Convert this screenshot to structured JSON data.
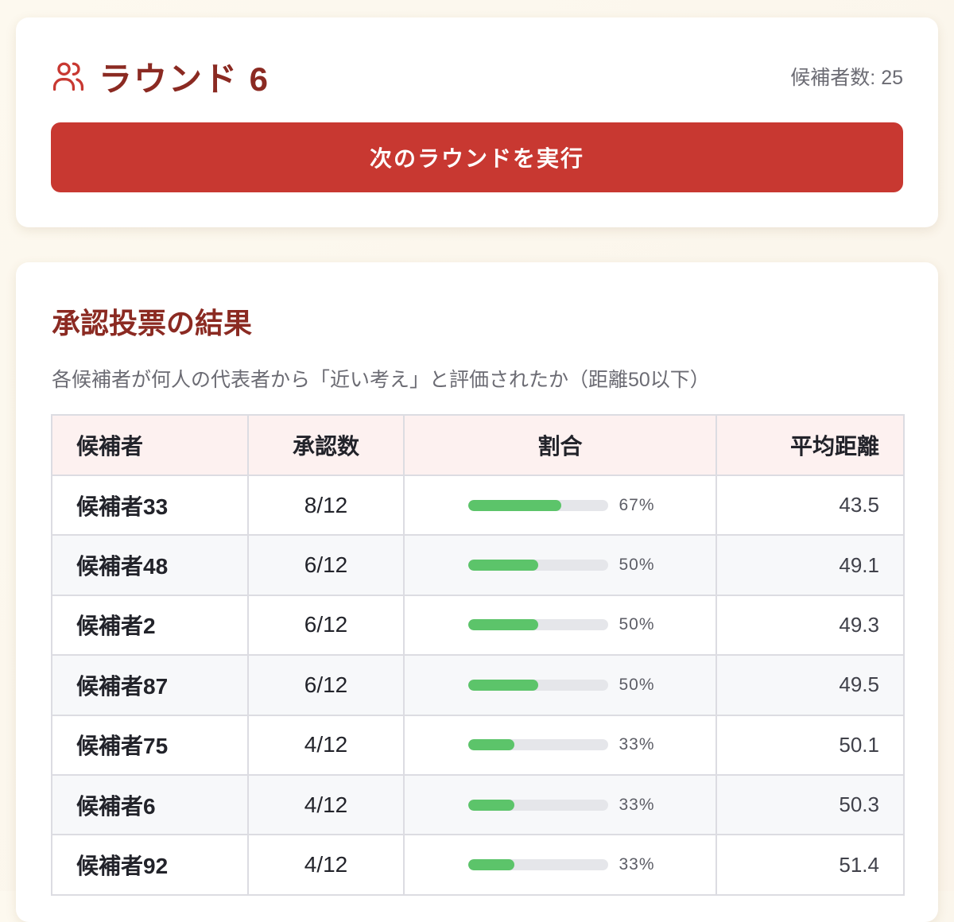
{
  "round": {
    "title": "ラウンド 6",
    "candidate_count": "候補者数: 25",
    "run_button": "次のラウンドを実行",
    "icon": "users-icon"
  },
  "results": {
    "title": "承認投票の結果",
    "description": "各候補者が何人の代表者から「近い考え」と評価されたか（距離50以下）",
    "headers": {
      "name": "候補者",
      "approved": "承認数",
      "ratio": "割合",
      "distance": "平均距離"
    },
    "rows": [
      {
        "name": "候補者33",
        "approved": "8/12",
        "ratio_label": "67%",
        "ratio": 0.67,
        "distance": "43.5"
      },
      {
        "name": "候補者48",
        "approved": "6/12",
        "ratio_label": "50%",
        "ratio": 0.5,
        "distance": "49.1"
      },
      {
        "name": "候補者2",
        "approved": "6/12",
        "ratio_label": "50%",
        "ratio": 0.5,
        "distance": "49.3"
      },
      {
        "name": "候補者87",
        "approved": "6/12",
        "ratio_label": "50%",
        "ratio": 0.5,
        "distance": "49.5"
      },
      {
        "name": "候補者75",
        "approved": "4/12",
        "ratio_label": "33%",
        "ratio": 0.33,
        "distance": "50.1"
      },
      {
        "name": "候補者6",
        "approved": "4/12",
        "ratio_label": "33%",
        "ratio": 0.33,
        "distance": "50.3"
      },
      {
        "name": "候補者92",
        "approved": "4/12",
        "ratio_label": "33%",
        "ratio": 0.33,
        "distance": "51.4"
      }
    ]
  },
  "colors": {
    "accent": "#c83831",
    "title": "#8b2a22",
    "bar": "#5cc46a"
  }
}
